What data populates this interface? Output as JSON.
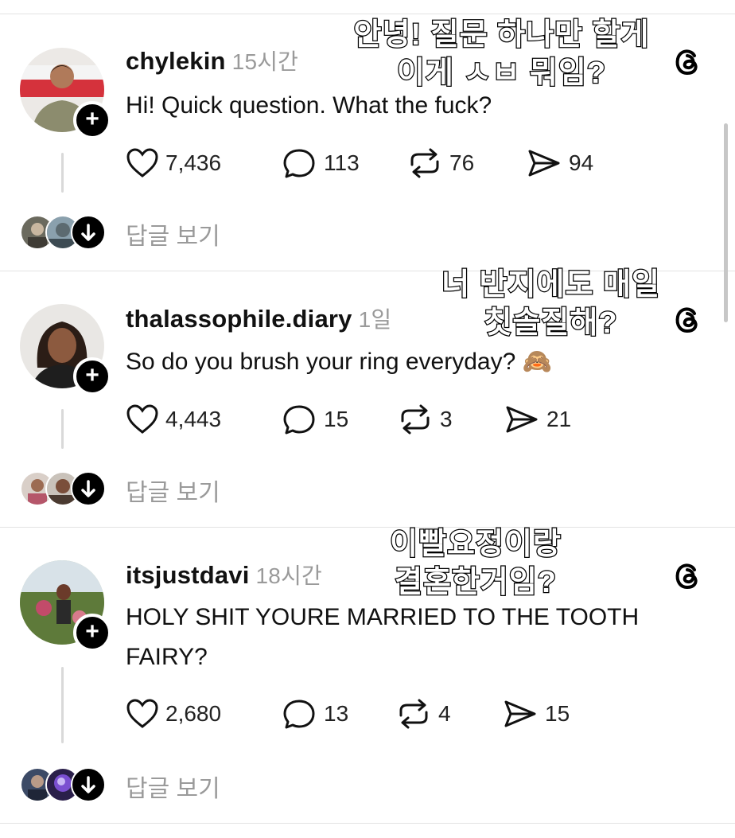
{
  "posts": [
    {
      "username": "chylekin",
      "time": "15시간",
      "text": "Hi! Quick question. What the fuck?",
      "likes": "7,436",
      "comments": "113",
      "reposts": "76",
      "shares": "94",
      "view_replies": "답글 보기",
      "overlay_line1": "안녕! 질문 하나만 할게",
      "overlay_line2": "이게 ㅅㅂ 뭐임?"
    },
    {
      "username": "thalassophile.diary",
      "time": "1일",
      "text": "So do you brush your ring everyday? 🙈",
      "likes": "4,443",
      "comments": "15",
      "reposts": "3",
      "shares": "21",
      "view_replies": "답글 보기",
      "overlay_line1": "너 반지에도 매일",
      "overlay_line2": "칫솔질해?"
    },
    {
      "username": "itsjustdavi",
      "time": "18시간",
      "text": "HOLY SHIT YOURE MARRIED TO THE TOOTH FAIRY?",
      "likes": "2,680",
      "comments": "13",
      "reposts": "4",
      "shares": "15",
      "view_replies": "답글 보기",
      "overlay_line1": "이빨요정이랑",
      "overlay_line2": "결혼한거임?"
    }
  ],
  "icons": {
    "like": "heart-icon",
    "comment": "comment-bubble-icon",
    "repost": "repost-icon",
    "share": "send-icon",
    "follow": "plus-icon",
    "threads": "threads-logo-icon",
    "expand": "arrow-down-icon"
  }
}
